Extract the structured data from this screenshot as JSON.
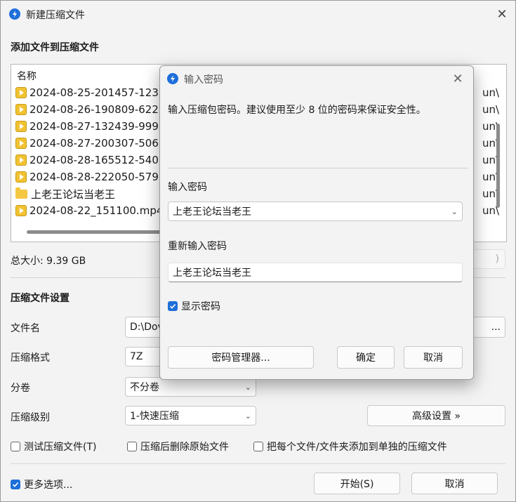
{
  "window": {
    "title": "新建压缩文件",
    "close_glyph": "✕"
  },
  "files_section": {
    "heading": "添加文件到压缩文件",
    "column_name": "名称",
    "rows": [
      {
        "name": "2024-08-25-201457-123.r",
        "type": "video",
        "tail": "un\\"
      },
      {
        "name": "2024-08-26-190809-622.r",
        "type": "video",
        "tail": "un\\"
      },
      {
        "name": "2024-08-27-132439-999.r",
        "type": "video",
        "tail": "un\\"
      },
      {
        "name": "2024-08-27-200307-506.r",
        "type": "video",
        "tail": "un\\"
      },
      {
        "name": "2024-08-28-165512-540.r",
        "type": "video",
        "tail": "un\\"
      },
      {
        "name": "2024-08-28-222050-579.r",
        "type": "video",
        "tail": "un\\"
      },
      {
        "name": "上老王论坛当老王",
        "type": "folder",
        "tail": "un\\"
      },
      {
        "name": "2024-08-22_151100.mp4",
        "type": "video",
        "tail": "un\\"
      }
    ],
    "total_size": "总大小: 9.39 GB",
    "hidden_button_tail": ")"
  },
  "settings": {
    "heading": "压缩文件设置",
    "filename_label": "文件名",
    "filename_value": "D:\\Dov",
    "browse_tail": "...",
    "format_label": "压缩格式",
    "format_value": "7Z",
    "split_label": "分卷",
    "split_value": "不分卷",
    "level_label": "压缩级别",
    "level_value": "1-快速压缩",
    "advanced_button": "高级设置 »",
    "test_checkbox": "测试压缩文件(T)",
    "delete_checkbox": "压缩后删除原始文件",
    "separate_checkbox": "把每个文件/文件夹添加到单独的压缩文件"
  },
  "footer": {
    "more_options": "更多选项...",
    "start_button": "开始(S)",
    "cancel_button": "取消"
  },
  "password_dialog": {
    "title": "输入密码",
    "close_glyph": "✕",
    "description": "输入压缩包密码。建议使用至少 8 位的密码来保证安全性。",
    "enter_label": "输入密码",
    "enter_value": "上老王论坛当老王",
    "reenter_label": "重新输入密码",
    "reenter_value": "上老王论坛当老王",
    "show_password": "显示密码",
    "manager_button": "密码管理器...",
    "ok_button": "确定",
    "cancel_button": "取消"
  },
  "colors": {
    "accent": "#1e6fd9",
    "window_bg": "#f3f3f3",
    "file_icon": "#f1c232"
  }
}
